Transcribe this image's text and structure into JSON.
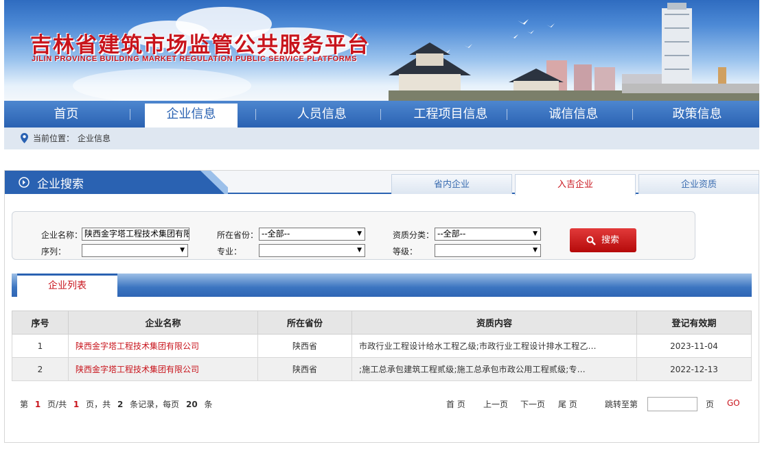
{
  "header": {
    "title_cn": "吉林省建筑市场监管公共服务平台",
    "title_en": "JILIN PROVINCE BUILDING MARKET REGULATION PUBLIC SERVICE PLATFORMS"
  },
  "nav": [
    {
      "label": "首页"
    },
    {
      "label": "企业信息",
      "active": true
    },
    {
      "label": "人员信息"
    },
    {
      "label": "工程项目信息"
    },
    {
      "label": "诚信信息"
    },
    {
      "label": "政策信息"
    }
  ],
  "breadcrumb": {
    "prefix": "当前位置：",
    "current": "企业信息"
  },
  "section": {
    "title": "企业搜索"
  },
  "tabs": [
    {
      "label": "省内企业"
    },
    {
      "label": "入吉企业",
      "active": true
    },
    {
      "label": "企业资质"
    }
  ],
  "search": {
    "company_label": "企业名称：",
    "company_value": "陕西金字塔工程技术集团有限",
    "province_label": "所在省份：",
    "province_value": "--全部--",
    "qualtype_label": "资质分类：",
    "qualtype_value": "--全部--",
    "sequence_label": "序列：",
    "sequence_value": "",
    "major_label": "专业：",
    "major_value": "",
    "grade_label": "等级：",
    "grade_value": "",
    "button": "搜索"
  },
  "list": {
    "tab": "企业列表",
    "columns": [
      "序号",
      "企业名称",
      "所在省份",
      "资质内容",
      "登记有效期"
    ],
    "rows": [
      [
        "1",
        "陕西金字塔工程技术集团有限公司",
        "陕西省",
        "市政行业工程设计给水工程乙级;市政行业工程设计排水工程乙...",
        "2023-11-04"
      ],
      [
        "2",
        "陕西金字塔工程技术集团有限公司",
        "陕西省",
        ";施工总承包建筑工程贰级;施工总承包市政公用工程贰级;专...",
        "2022-12-13"
      ]
    ]
  },
  "pager": {
    "t1": "第",
    "page": "1",
    "t2": "页/共",
    "total_pages": "1",
    "t3": "页，共",
    "records": "2",
    "t4": "条记录，每页",
    "per_page": "20",
    "t5": "条",
    "first": "首 页",
    "prev": "上一页",
    "next": "下一页",
    "last": "尾 页",
    "goto_label": "跳转至第",
    "goto_suffix": "页",
    "go": "GO"
  },
  "colors": {
    "brand_red": "#c8141c",
    "nav_blue": "#2a62b2"
  }
}
